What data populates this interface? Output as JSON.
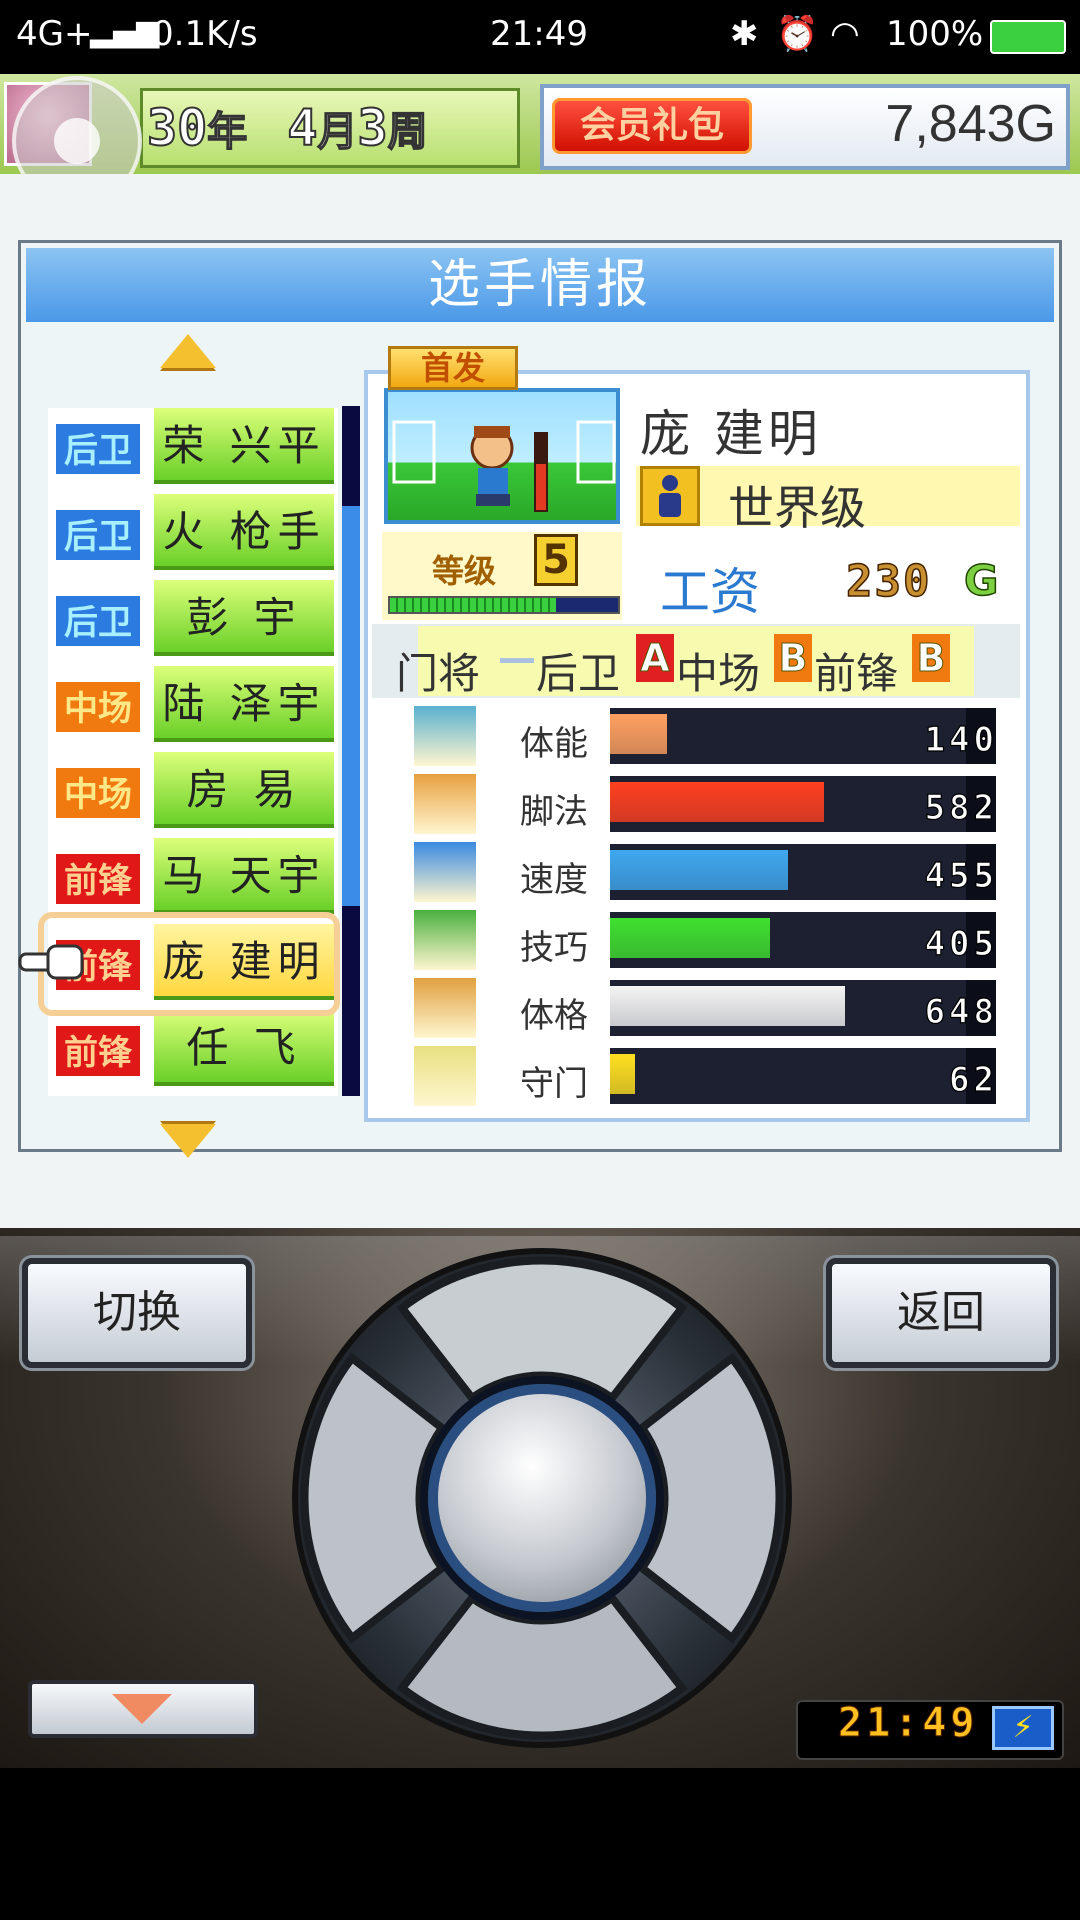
{
  "status_bar": {
    "network": "4G+",
    "speed": "0.1K/s",
    "time": "21:49",
    "battery": "100%"
  },
  "header": {
    "year_num": "30",
    "year_unit": "年",
    "month_num": "4",
    "month_unit": "月",
    "week_num": "3",
    "week_unit": "周",
    "vip_label": "会员礼包",
    "gold": "7,843G"
  },
  "panel": {
    "title": "选手情报"
  },
  "roster": [
    {
      "pos": "后卫",
      "type": "df",
      "name": "荣 兴平"
    },
    {
      "pos": "后卫",
      "type": "df",
      "name": "火 枪手"
    },
    {
      "pos": "后卫",
      "type": "df",
      "name": "彭 宇"
    },
    {
      "pos": "中场",
      "type": "mf",
      "name": "陆 泽宇"
    },
    {
      "pos": "中场",
      "type": "mf",
      "name": "房 易"
    },
    {
      "pos": "前锋",
      "type": "fw",
      "name": "马 天宇"
    },
    {
      "pos": "前锋",
      "type": "fw",
      "name": "庞 建明",
      "selected": true
    },
    {
      "pos": "前锋",
      "type": "fw",
      "name": "任 飞"
    }
  ],
  "player": {
    "starter_badge": "首发",
    "name": "庞 建明",
    "rank": "世界级",
    "level_label": "等级",
    "level": "5",
    "exp_fraction": 0.72,
    "salary_label": "工资",
    "salary": "230",
    "salary_unit": "G",
    "aptitudes": [
      {
        "label": "门将",
        "grade": "—",
        "color": "#8aa0c8"
      },
      {
        "label": "后卫",
        "grade": "A",
        "color": "#e02020"
      },
      {
        "label": "中场",
        "grade": "B",
        "color": "#f07a10"
      },
      {
        "label": "前锋",
        "grade": "B",
        "color": "#f07a10"
      }
    ],
    "stats": [
      {
        "label": "体能",
        "value": "140",
        "fraction": 0.16,
        "color": "#ffa060",
        "icon": "battery-icon",
        "icon_color": "#5ab0d0"
      },
      {
        "label": "脚法",
        "value": "582",
        "fraction": 0.6,
        "color": "#ff4020",
        "icon": "boot-kick-icon",
        "icon_color": "#e8a040"
      },
      {
        "label": "速度",
        "value": "455",
        "fraction": 0.5,
        "color": "#40a8f0",
        "icon": "running-man-icon",
        "icon_color": "#3a8ae0"
      },
      {
        "label": "技巧",
        "value": "405",
        "fraction": 0.45,
        "color": "#40e030",
        "icon": "dribble-icon",
        "icon_color": "#4ab040"
      },
      {
        "label": "体格",
        "value": "648",
        "fraction": 0.66,
        "color": "#f4f4f4",
        "icon": "muscle-icon",
        "icon_color": "#e0a040"
      },
      {
        "label": "守门",
        "value": "62",
        "fraction": 0.07,
        "color": "#ffe020",
        "icon": "glove-icon",
        "icon_color": "#e8e080"
      }
    ]
  },
  "controls": {
    "switch_label": "切换",
    "back_label": "返回",
    "clock": "21:49"
  }
}
